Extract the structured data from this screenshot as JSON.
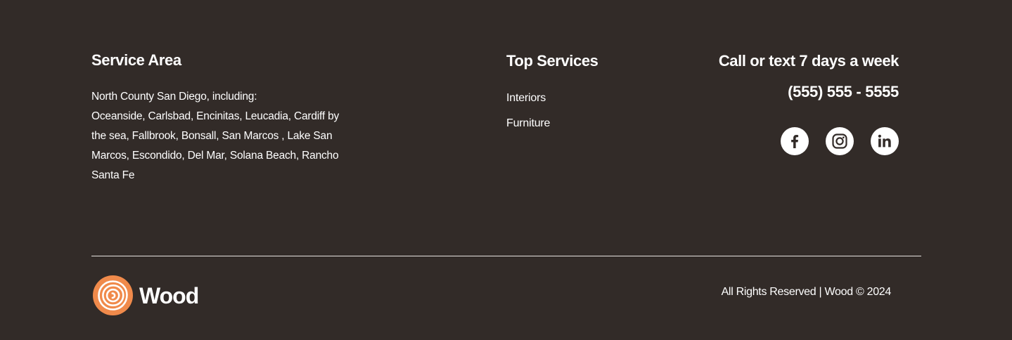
{
  "service_area": {
    "heading": "Service Area",
    "intro": "North County San Diego, including:",
    "cities": "Oceanside, Carlsbad, Encinitas, Leucadia, Cardiff by the sea, Fallbrook, Bonsall, San Marcos , Lake San Marcos, Escondido, Del Mar, Solana Beach, Rancho Santa Fe"
  },
  "top_services": {
    "heading": "Top Services",
    "links": [
      "Interiors",
      "Furniture"
    ]
  },
  "contact": {
    "heading": "Call or text 7 days a week",
    "phone": "(555) 555 - 5555",
    "socials": [
      "facebook-icon",
      "instagram-icon",
      "linkedin-icon"
    ]
  },
  "brand": {
    "name": "Wood",
    "accent_color": "#f08a4b"
  },
  "copyright": "All Rights Reserved | Wood © 2024",
  "colors": {
    "background": "#322b28",
    "text": "#ffffff"
  }
}
